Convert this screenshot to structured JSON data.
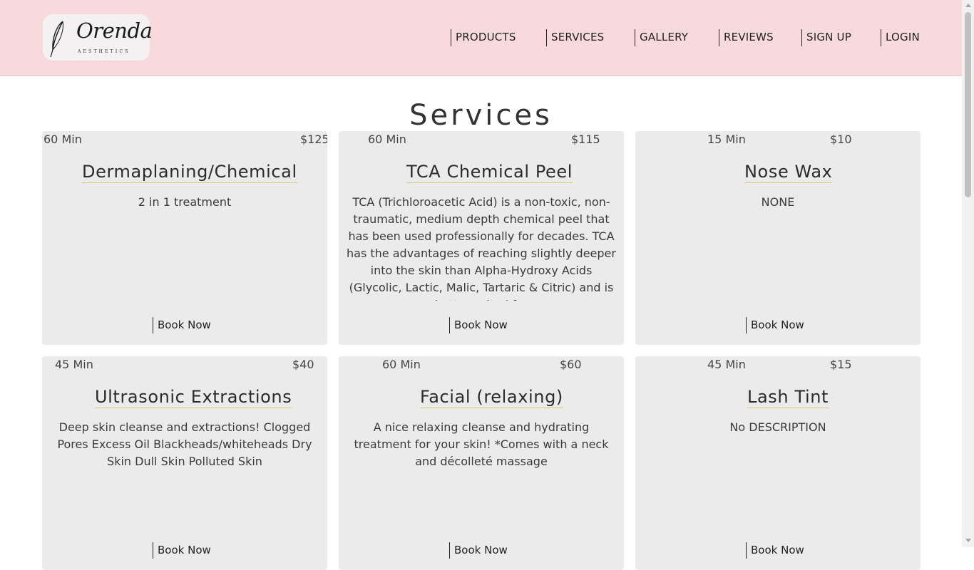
{
  "brand": {
    "name": "Orenda",
    "sub": "AESTHETICS"
  },
  "nav": [
    "PRODUCTS",
    "SERVICES",
    "GALLERY",
    "REVIEWS",
    "SIGN UP",
    "LOGIN"
  ],
  "page_title": "Services",
  "services": [
    {
      "duration": "60 Min",
      "price": "$125",
      "name": "Dermaplaning/Chemical",
      "description": "2 in 1 treatment",
      "book": "Book Now"
    },
    {
      "duration": "60 Min",
      "price": "$115",
      "name": "TCA Chemical Peel",
      "description": "TCA (Trichloroacetic Acid) is a non-toxic, non-traumatic, medium depth chemical peel that has been used professionally for decades. TCA has the advantages of reaching slightly deeper into the skin than Alpha-Hydroxy Acids (Glycolic, Lactic, Malic, Tartaric & Citric) and is better suited for",
      "book": "Book Now"
    },
    {
      "duration": "15 Min",
      "price": "$10",
      "name": "Nose Wax",
      "description": "NONE",
      "book": "Book Now"
    },
    {
      "duration": "45 Min",
      "price": "$40",
      "name": "Ultrasonic Extractions",
      "description": "Deep skin cleanse and extractions! Clogged Pores Excess Oil Blackheads/whiteheads Dry Skin Dull Skin Polluted Skin",
      "book": "Book Now"
    },
    {
      "duration": "60 Min",
      "price": "$60",
      "name": "Facial (relaxing)",
      "description": "A nice relaxing cleanse and hydrating treatment for your skin! *Comes with a neck and décolleté massage",
      "book": "Book Now"
    },
    {
      "duration": "45 Min",
      "price": "$15",
      "name": "Lash Tint",
      "description": "No DESCRIPTION",
      "book": "Book Now"
    }
  ]
}
